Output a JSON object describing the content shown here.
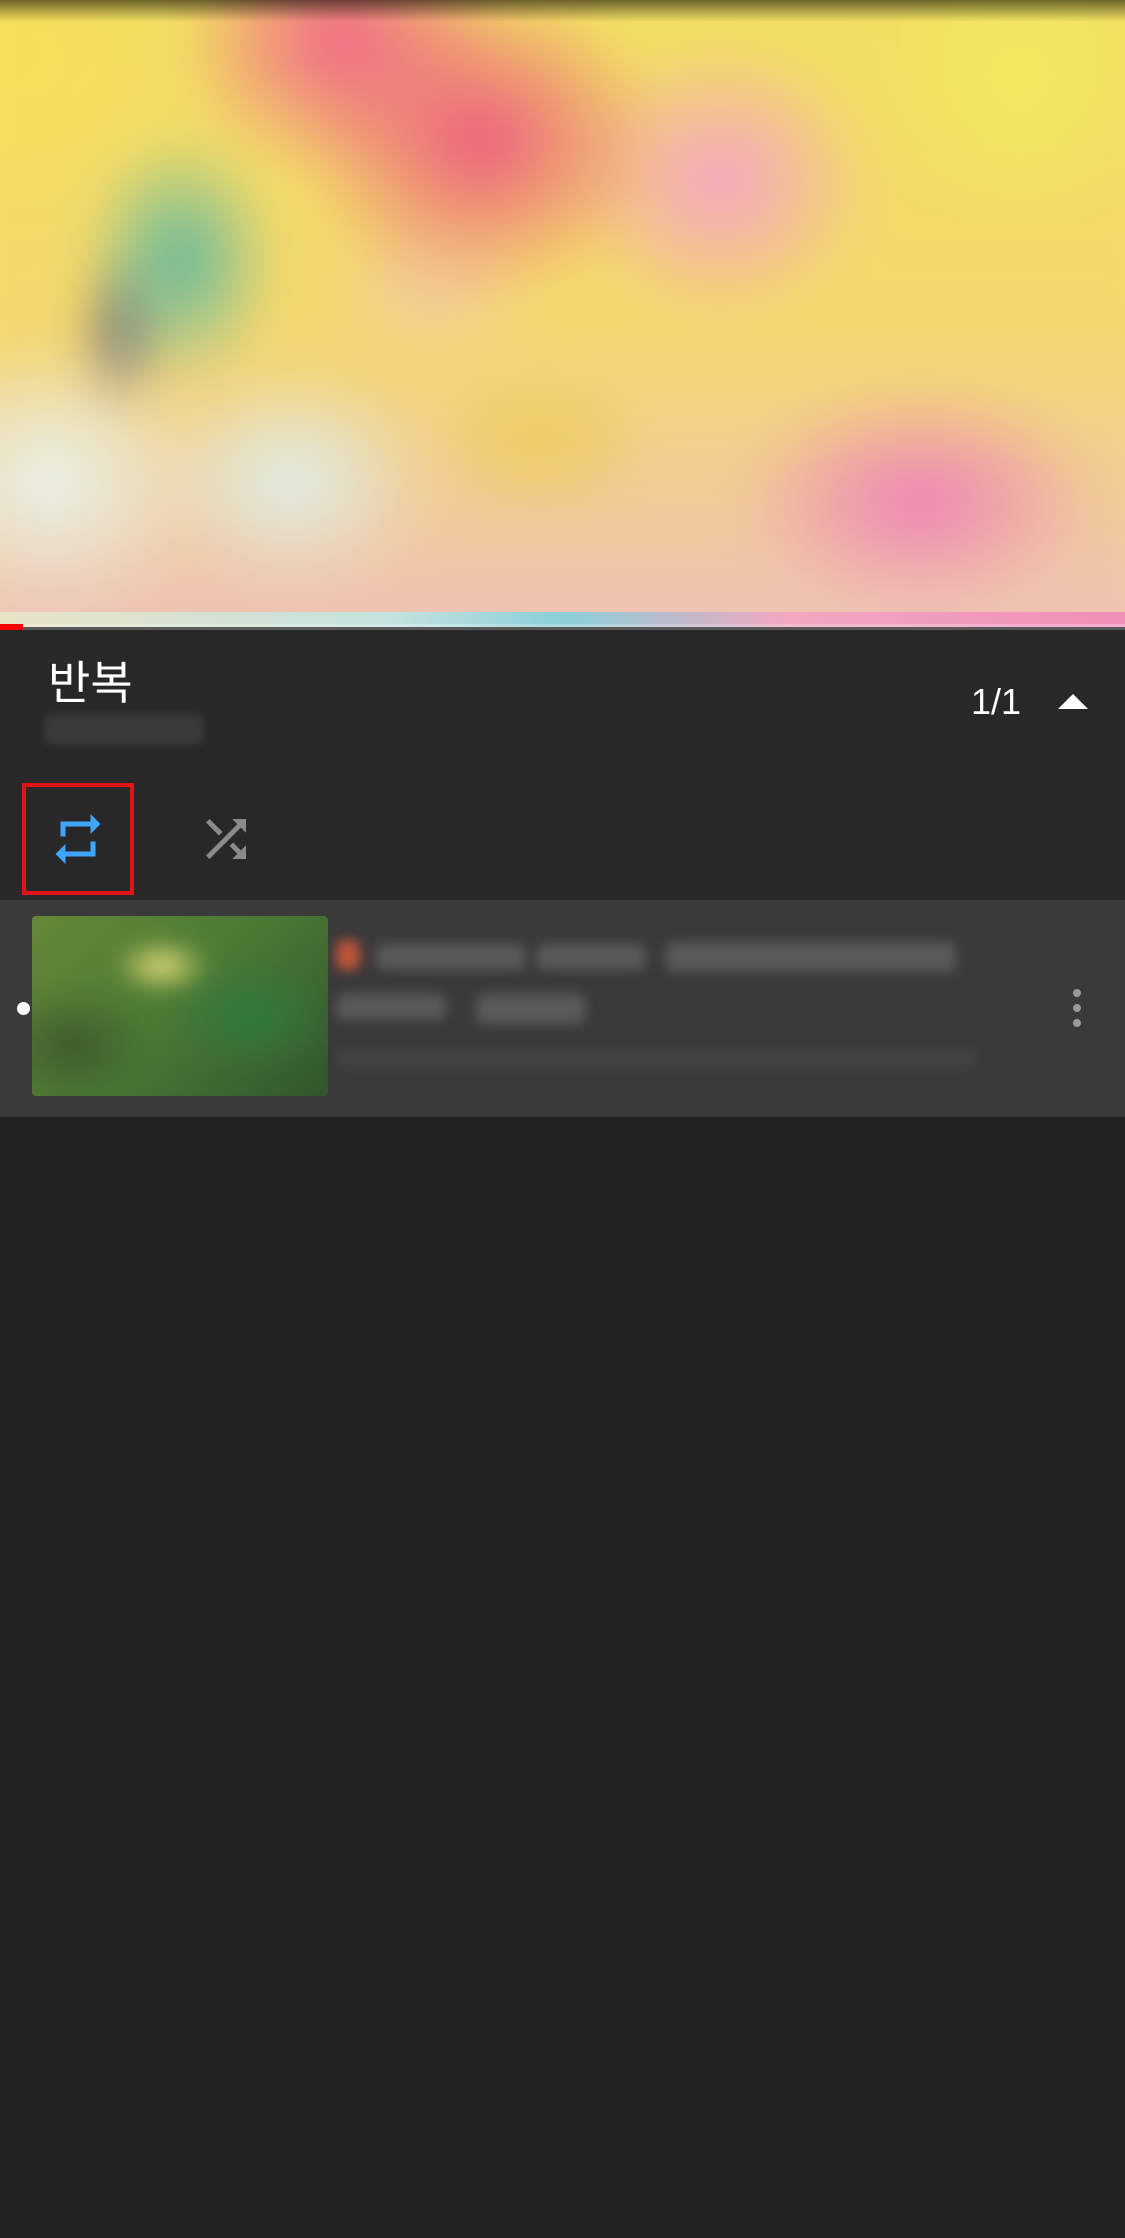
{
  "player": {
    "progress_fraction": 0.02,
    "progress_color": "#ff0000"
  },
  "playlist": {
    "title": "반복",
    "count": "1/1",
    "collapse_icon": "caret-up-icon"
  },
  "controls": {
    "loop_icon": "repeat-icon",
    "loop_active": true,
    "loop_color": "#3ea6ff",
    "shuffle_icon": "shuffle-icon",
    "shuffle_active": false,
    "shuffle_color": "#8a8a8a",
    "highlight_color": "#e01414"
  },
  "items": [
    {
      "now_playing": true,
      "more_icon": "more-vert-icon"
    }
  ]
}
